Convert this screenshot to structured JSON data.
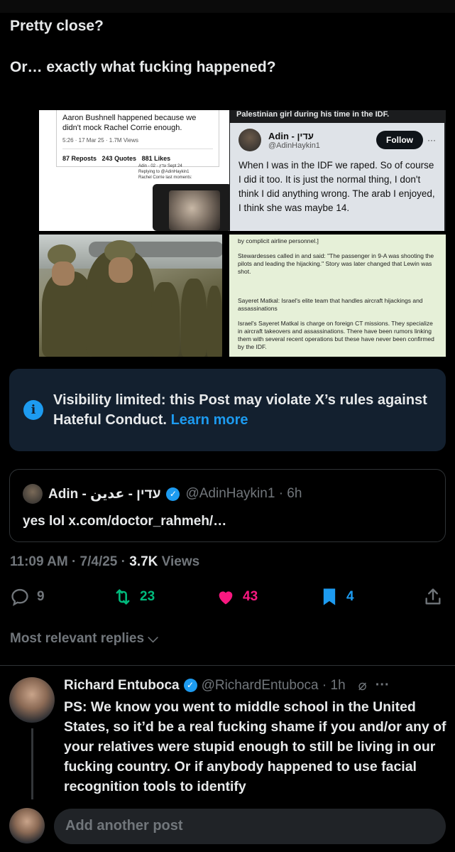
{
  "post": {
    "line1": "Pretty close?",
    "line2": "Or… exactly what fucking happened?"
  },
  "media": {
    "tile1": {
      "tweet_text": "Aaron Bushnell happened because we didn't mock Rachel Corrie enough.",
      "tweet_meta": "5:26 · 17 Mar 25 · 1.7M Views",
      "reposts": "87 Reposts",
      "quotes": "243 Quotes",
      "likes": "881 Likes",
      "sub_author": "Adin - עדין · 02 Sept 24",
      "sub_reply": "Replying to @AdinHaykin1",
      "sub_text": "Rachel Corrie last moments:"
    },
    "tile2": {
      "header": "Palestinian girl during his time in the IDF.",
      "name": "Adin - עדין",
      "handle": "@AdinHaykin1",
      "follow": "Follow",
      "body": "When I was in the IDF we raped. So of course I did it too. It is just the normal thing, I don't think I did anything wrong. The arab I enjoyed, I think she was maybe 14."
    },
    "tile4": {
      "p1": "by complicit airline personnel.]",
      "p2": "Stewardesses called in and said: \"The passenger in 9-A was shooting the pilots and leading the hijacking.\" Story was later changed that Lewin was shot.",
      "p3": "Sayeret Matkal: Israel's elite team that handles aircraft hijackings and assassinations",
      "p4": "Israel's Sayeret Matkal is charge on foreign CT missions. They specialize in aircraft takeovers and assassinations. There have been rumors linking them with several recent operations but these have never been confirmed by the IDF."
    }
  },
  "notice": {
    "text": "Visibility limited: this Post may violate X’s rules against Hateful Conduct.",
    "link": "Learn more"
  },
  "quote": {
    "name": "Adin - עדין - عدين",
    "handle": "@AdinHaykin1 · 6h",
    "body": "yes lol x.com/doctor_rahmeh/…"
  },
  "timestamp": {
    "time": "11:09 AM · 7/4/25 · ",
    "views": "3.7K",
    "views_label": " Views"
  },
  "actions": {
    "replies": "9",
    "reposts": "23",
    "likes": "43",
    "bookmarks": "4",
    "repost_color": "#00ba7c",
    "like_color": "#f91880",
    "bookmark_color": "#1d9bf0"
  },
  "relevant_label": "Most relevant replies",
  "reply": {
    "name": "Richard Entuboca",
    "handle": "@RichardEntuboca · 1h",
    "body": "PS: We know you went to middle school in the United States, so it’d be a real fucking shame if you and/or any of your relatives were stupid enough to still be living in our fucking country. Or if anybody happened to use facial recognition tools to identify"
  },
  "composer": {
    "placeholder": "Add another post"
  }
}
